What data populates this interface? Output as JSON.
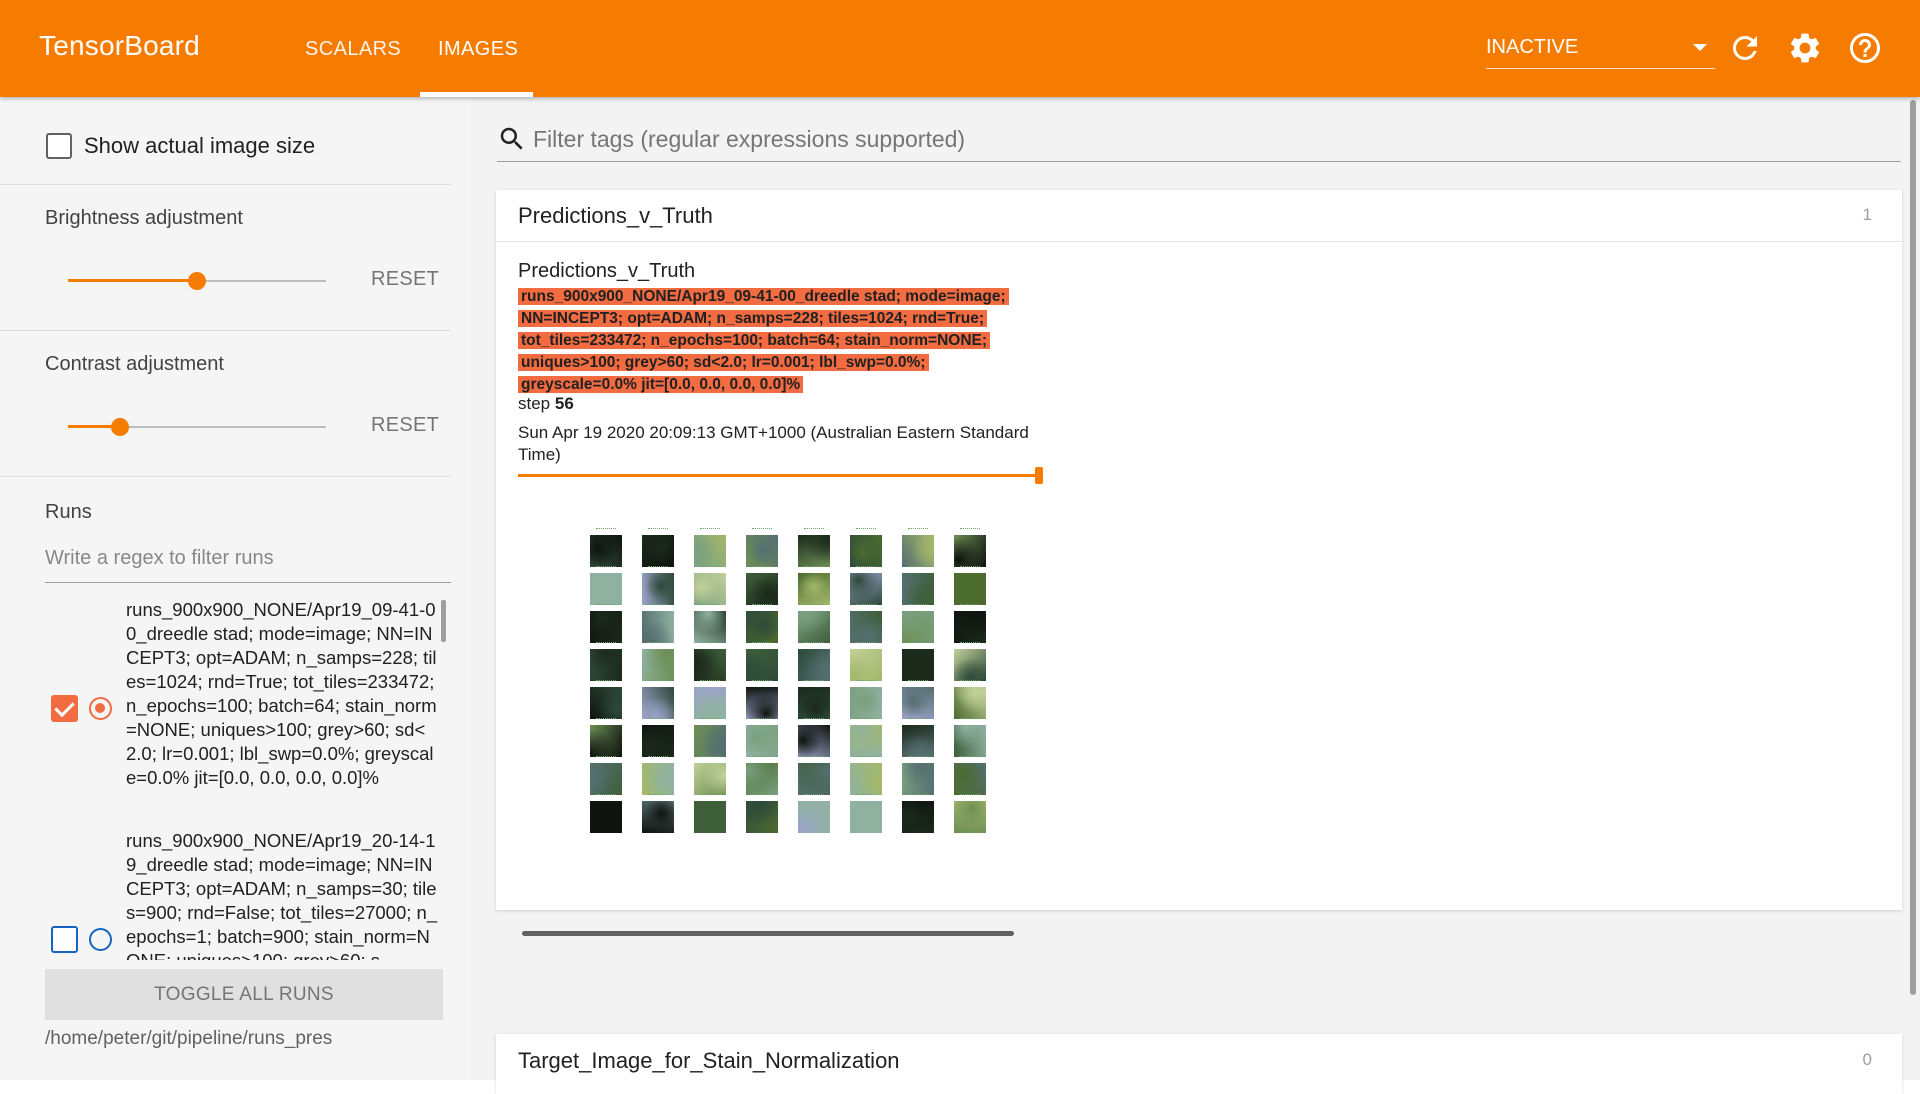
{
  "app": {
    "title": "TensorBoard"
  },
  "nav": {
    "tabs": [
      {
        "label": "SCALARS"
      },
      {
        "label": "IMAGES"
      }
    ],
    "active_tab": "IMAGES"
  },
  "status_select": {
    "value": "INACTIVE"
  },
  "icons": {
    "refresh": "refresh-icon",
    "settings": "gear-icon",
    "help": "help-icon",
    "search": "search-icon",
    "dropdown": "chevron-down-icon"
  },
  "colors": {
    "brand": "#f57c00",
    "selected_run": "#f26b41",
    "unselected_run": "#1565c0"
  },
  "sidebar": {
    "show_actual_size": {
      "label": "Show actual image size",
      "checked": false
    },
    "brightness": {
      "label": "Brightness adjustment",
      "reset_label": "RESET",
      "value": 0.5
    },
    "contrast": {
      "label": "Contrast adjustment",
      "reset_label": "RESET",
      "value": 0.2
    },
    "runs": {
      "title": "Runs",
      "filter_placeholder": "Write a regex to filter runs",
      "items": [
        {
          "label": "runs_900x900_NONE/Apr19_09-41-00_dreedle stad; mode=image; NN=INCEPT3; opt=ADAM; n_samps=228; tiles=1024; rnd=True; tot_tiles=233472; n_epochs=100; batch=64; stain_norm=NONE; uniques>100; grey>60; sd<2.0; lr=0.001; lbl_swp=0.0%; greyscale=0.0% jit=[0.0, 0.0, 0.0, 0.0]%",
          "checked": true,
          "selected": true
        },
        {
          "label": "runs_900x900_NONE/Apr19_20-14-19_dreedle stad; mode=image; NN=INCEPT3; opt=ADAM; n_samps=30; tiles=900; rnd=False; tot_tiles=27000; n_epochs=1; batch=900; stain_norm=NONE; uniques>100; grey>60; s",
          "checked": false,
          "selected": false
        }
      ],
      "toggle_all_label": "TOGGLE ALL RUNS",
      "logdir": "/home/peter/git/pipeline/runs_pres"
    }
  },
  "main": {
    "filter_placeholder": "Filter tags (regular expressions supported)",
    "cards": [
      {
        "title": "Predictions_v_Truth",
        "count": "1",
        "image": {
          "tag": "Predictions_v_Truth",
          "run": "runs_900x900_NONE/Apr19_09-41-00_dreedle stad; mode=image; NN=INCEPT3; opt=ADAM; n_samps=228; tiles=1024; rnd=True; tot_tiles=233472; n_epochs=100; batch=64; stain_norm=NONE; uniques>100; grey>60; sd<2.0; lr=0.001; lbl_swp=0.0%; greyscale=0.0% jit=[0.0, 0.0, 0.0, 0.0]%",
          "step_label": "step",
          "step_value": "56",
          "wall_time": "Sun Apr 19 2020 20:09:13 GMT+1000 (Australian Eastern Standard Time)",
          "grid_rows": 8,
          "grid_cols": 8
        }
      },
      {
        "title": "Target_Image_for_Stain_Normalization",
        "count": "0"
      }
    ]
  }
}
